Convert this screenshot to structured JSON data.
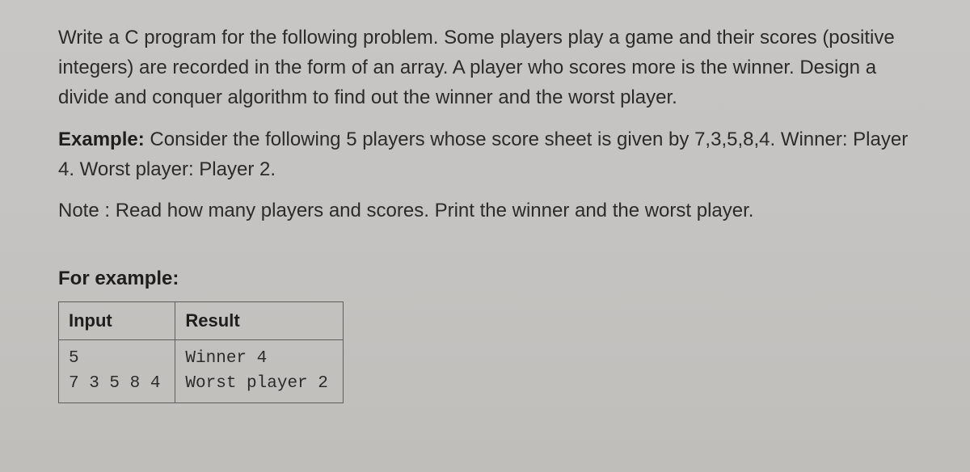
{
  "para1": "Write a C program for the following problem. Some players play a game and their scores (positive integers) are recorded in the form of an array. A player who scores more is the winner. Design a divide and conquer algorithm to find out the winner and the worst player.",
  "para2_bold": "Example:",
  "para2_rest": " Consider the following 5 players whose score sheet is given by 7,3,5,8,4. Winner: Player 4. Worst player: Player 2.",
  "para3": "Note : Read how many players and scores. Print the winner and the worst player.",
  "for_example_label": "For example:",
  "table": {
    "headers": {
      "input": "Input",
      "result": "Result"
    },
    "row": {
      "input": "5\n7 3 5 8 4",
      "result": "Winner 4\nWorst player 2"
    }
  }
}
